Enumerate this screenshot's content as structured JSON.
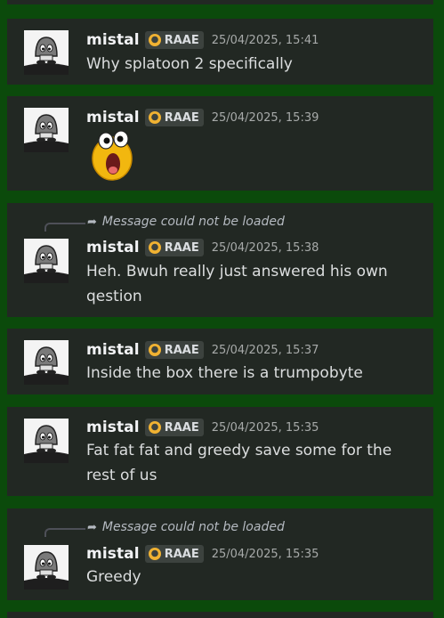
{
  "messages": [
    {
      "username": "mistal",
      "tag": "RAAE",
      "timestamp": "25/04/2025, 15:41",
      "lines": [
        "Why splatoon 2 specifically"
      ]
    },
    {
      "username": "mistal",
      "tag": "RAAE",
      "timestamp": "25/04/2025, 15:39",
      "emoji": "screaming-yellow-blob-emoji"
    },
    {
      "reply_text": "Message could not be loaded",
      "username": "mistal",
      "tag": "RAAE",
      "timestamp": "25/04/2025, 15:38",
      "lines": [
        "Heh. Bwuh really just answered his own",
        "qestion"
      ]
    },
    {
      "username": "mistal",
      "tag": "RAAE",
      "timestamp": "25/04/2025, 15:37",
      "lines": [
        "Inside the box there is a trumpobyte"
      ]
    },
    {
      "username": "mistal",
      "tag": "RAAE",
      "timestamp": "25/04/2025, 15:35",
      "lines": [
        "Fat fat fat and greedy save some for the",
        "rest of us"
      ]
    },
    {
      "reply_text": "Message could not be loaded",
      "username": "mistal",
      "tag": "RAAE",
      "timestamp": "25/04/2025, 15:35",
      "lines": [
        "Greedy"
      ]
    }
  ],
  "colors": {
    "page_background": "#0b4a0b",
    "message_background": "#222823",
    "tag_icon": "#f0b232"
  },
  "icons": {
    "avatar": "goomba-avatar-icon",
    "tag": "server-tag-icon",
    "reply": "reply-arrow-icon"
  }
}
